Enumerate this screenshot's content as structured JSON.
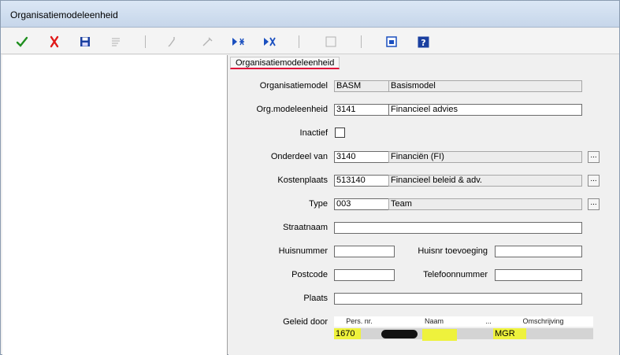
{
  "window": {
    "title": "Organisatiemodeleenheid"
  },
  "toolbar": {
    "icons": [
      "check-icon",
      "cancel-icon",
      "save-icon",
      "list-icon",
      "key-icon",
      "pen-icon",
      "insert-row-icon",
      "delete-row-icon",
      "blank-icon",
      "window-icon",
      "help-icon"
    ]
  },
  "tab": {
    "label": "Organisatiemodeleenheid"
  },
  "form": {
    "organisatiemodel": {
      "label": "Organisatiemodel",
      "code": "BASM",
      "name": "Basismodel"
    },
    "org_modeleenheid": {
      "label": "Org.modeleenheid",
      "code": "3141",
      "name": "Financieel advies"
    },
    "inactief": {
      "label": "Inactief",
      "checked": false
    },
    "onderdeel_van": {
      "label": "Onderdeel van",
      "code": "3140",
      "name": "Financiën (FI)"
    },
    "kostenplaats": {
      "label": "Kostenplaats",
      "code": "513140",
      "name": "Financieel beleid & adv."
    },
    "type": {
      "label": "Type",
      "code": "003",
      "name": "Team"
    },
    "straatnaam": {
      "label": "Straatnaam",
      "value": ""
    },
    "huisnummer": {
      "label": "Huisnummer",
      "value": ""
    },
    "huisnr_toevoeging": {
      "label": "Huisnr toevoeging",
      "value": ""
    },
    "postcode": {
      "label": "Postcode",
      "value": ""
    },
    "telefoonnummer": {
      "label": "Telefoonnummer",
      "value": ""
    },
    "plaats": {
      "label": "Plaats",
      "value": ""
    },
    "lookup_label": "..."
  },
  "geleid_door": {
    "label": "Geleid door",
    "columns": [
      "Pers. nr.",
      "Naam",
      "...",
      "Omschrijving"
    ],
    "rows": [
      {
        "pers_nr": "1670",
        "naam": "",
        "omschrijving": "MGR"
      }
    ]
  },
  "colors": {
    "highlight": "#eef23c",
    "tab_underline": "#e0103a",
    "check": "#1f8f1f",
    "cancel": "#e01818",
    "accent": "#1a4fbf"
  }
}
